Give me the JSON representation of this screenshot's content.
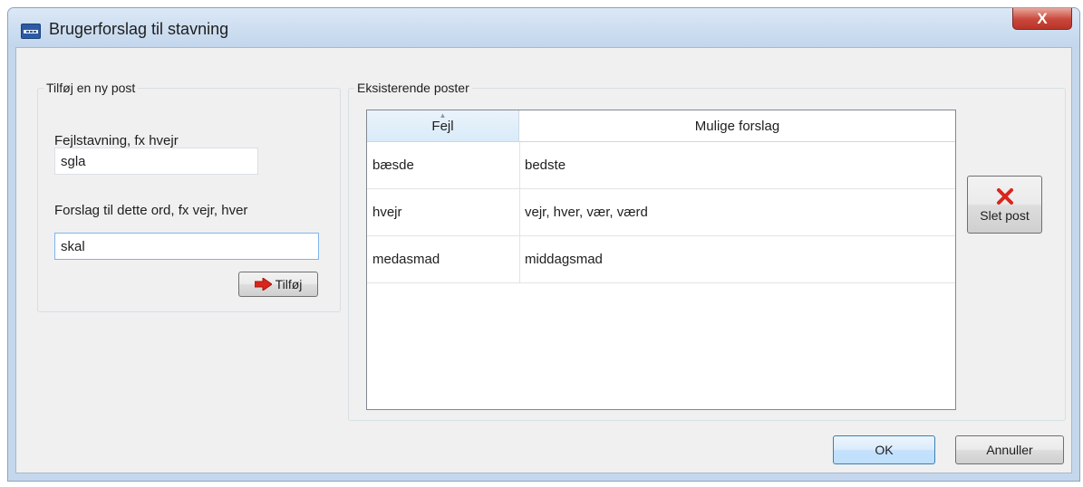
{
  "window": {
    "title": "Brugerforslag til stavning",
    "close_label": "X"
  },
  "add_group": {
    "legend": "Tilføj en ny post",
    "misspelling_label": "Fejlstavning, fx hvejr",
    "misspelling_value": "sgla",
    "suggestion_label": "Forslag til dette ord, fx vejr, hver",
    "suggestion_value": "skal",
    "add_button_label": "Tilføj"
  },
  "existing_group": {
    "legend": "Eksisterende poster",
    "columns": [
      "Fejl",
      "Mulige forslag"
    ],
    "rows": [
      {
        "error": "bæsde",
        "suggestions": "bedste"
      },
      {
        "error": "hvejr",
        "suggestions": "vejr, hver, vær, værd"
      },
      {
        "error": "medasmad",
        "suggestions": "middagsmad"
      }
    ],
    "delete_button_label": "Slet post"
  },
  "footer": {
    "ok_label": "OK",
    "cancel_label": "Annuller"
  },
  "icons": {
    "app": "app-icon",
    "add": "red-arrow-right-icon",
    "delete": "red-x-icon"
  },
  "colors": {
    "accent_red": "#d9261c"
  }
}
